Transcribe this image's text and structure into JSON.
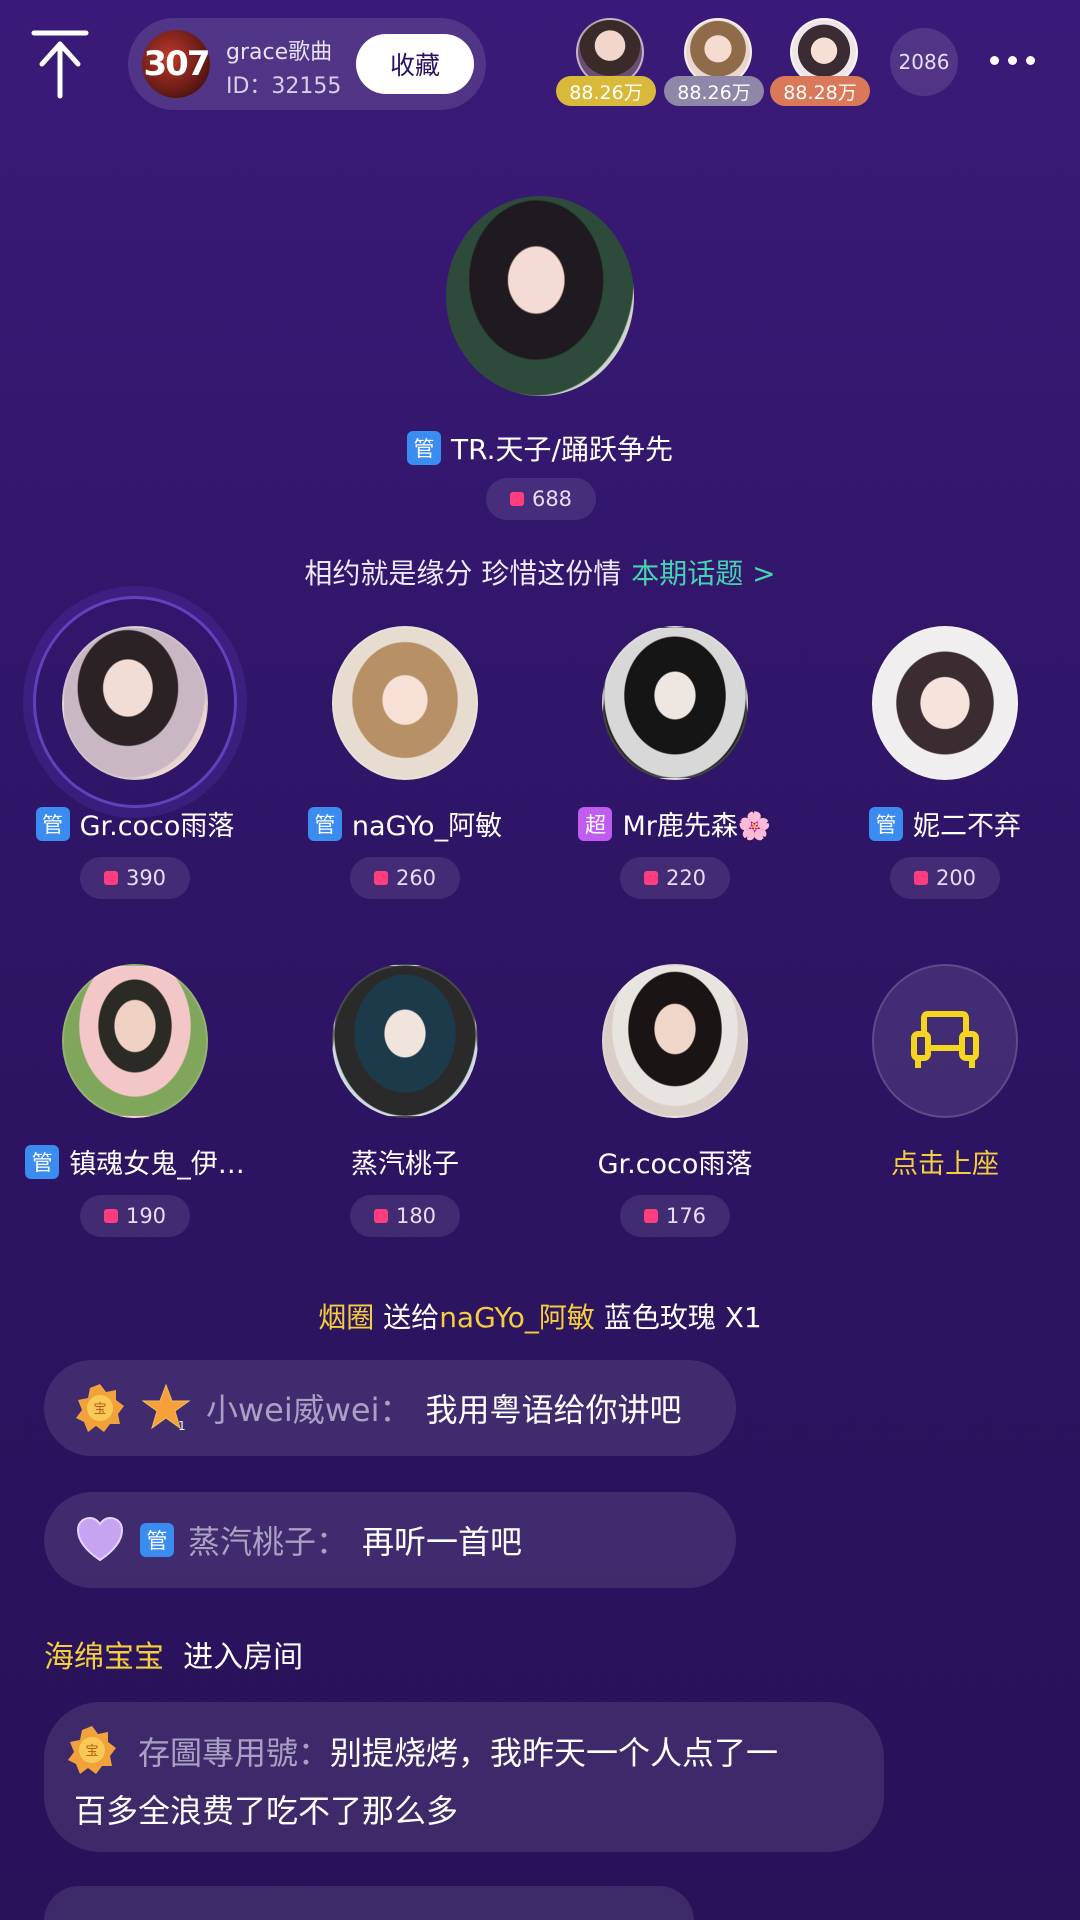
{
  "header": {
    "room_name": "grace歌曲",
    "room_id": "ID：32155",
    "logo_text": "307",
    "favorite_label": "收藏",
    "top_contributors": [
      {
        "amount": "88.26万",
        "badge_color": "#d8b93a"
      },
      {
        "amount": "88.26万",
        "badge_color": "#8e87a8"
      },
      {
        "amount": "88.28万",
        "badge_color": "#d9795a"
      }
    ],
    "online_count": "2086"
  },
  "host": {
    "tag": "管",
    "name": "TR.天子/踊跃争先",
    "score": "688"
  },
  "topic": {
    "text": "相约就是缘分 珍惜这份情",
    "link": "本期话题 >"
  },
  "seats": [
    {
      "tag": "管",
      "tag_type": "guan",
      "name": "Gr.coco雨落",
      "score": "390",
      "speaking": true
    },
    {
      "tag": "管",
      "tag_type": "guan",
      "name": "naGYo_阿敏",
      "score": "260"
    },
    {
      "tag": "超",
      "tag_type": "chao",
      "name": "Mr鹿先森🌸",
      "score": "220"
    },
    {
      "tag": "管",
      "tag_type": "guan",
      "name": "妮二不弃",
      "score": "200"
    },
    {
      "tag": "管",
      "tag_type": "guan",
      "name": "镇魂女鬼_伊…",
      "score": "190"
    },
    {
      "tag": "",
      "tag_type": "",
      "name": "蒸汽桃子",
      "score": "180"
    },
    {
      "tag": "",
      "tag_type": "",
      "name": "Gr.coco雨落",
      "score": "176"
    }
  ],
  "empty_seat": {
    "label": "点击上座",
    "icon": "armchair-icon"
  },
  "feed": {
    "gift": {
      "sender": "烟圈",
      "verb": "送给",
      "receiver": "naGYo_阿敏",
      "item": "蓝色玫瑰",
      "count": "X1"
    },
    "messages": [
      {
        "name": "小wei威wei：",
        "text": "我用粤语给你讲吧",
        "medals": [
          "gold-medal-icon",
          "star-level-1-icon"
        ]
      },
      {
        "name": "蒸汽桃子：",
        "text": "再听一首吧",
        "tag": "管",
        "medals": [
          "heart-icon"
        ]
      },
      {
        "name": "存圖專用號：",
        "text_line1": "别提烧烤，我昨天一个人点了一",
        "text_line2": "百多全浪费了吃不了那么多",
        "medals": [
          "gold-medal-icon"
        ]
      }
    ],
    "enter": {
      "user": "海绵宝宝",
      "text": "进入房间"
    }
  }
}
